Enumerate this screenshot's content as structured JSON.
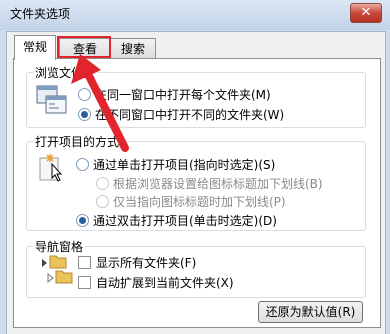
{
  "window": {
    "title": "文件夹选项",
    "close_glyph": "✕"
  },
  "tabs": [
    "常规",
    "查看",
    "搜索"
  ],
  "browse": {
    "legend": "浏览文件夹",
    "options": [
      "在同一窗口中打开每个文件夹(M)",
      "在不同窗口中打开不同的文件夹(W)"
    ],
    "selected": 1
  },
  "click": {
    "legend": "打开项目的方式",
    "single": "通过单击打开项目(指向时选定)(S)",
    "sub1": "根据浏览器设置给图标标题加下划线(B)",
    "sub2": "仅当指向图标标题时加下划线(P)",
    "double": "通过双击打开项目(单击时选定)(D)",
    "selected": "double"
  },
  "nav": {
    "legend": "导航窗格",
    "show_all": "显示所有文件夹(F)",
    "auto_expand": "自动扩展到当前文件夹(X)"
  },
  "restore_button": "还原为默认值(R)",
  "annotation": {
    "color": "#e0252c",
    "target": "查看"
  }
}
